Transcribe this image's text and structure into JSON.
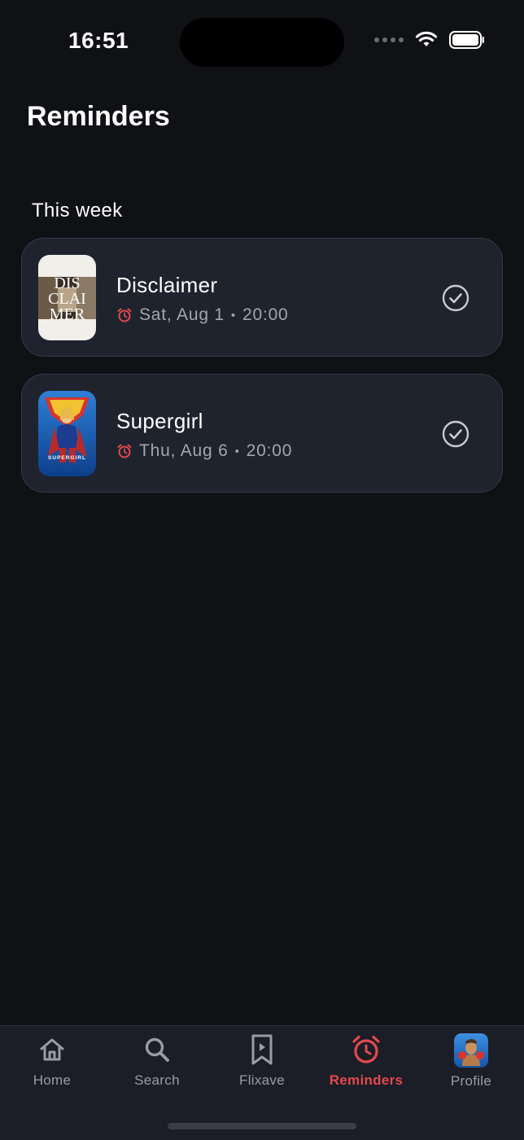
{
  "status": {
    "time": "16:51"
  },
  "header": {
    "title": "Reminders"
  },
  "section": {
    "title": "This week"
  },
  "reminders": [
    {
      "title": "Disclaimer",
      "day": "Sat, Aug 1",
      "time": "20:00",
      "poster_text": [
        "DIS",
        "CLAI",
        "MER"
      ]
    },
    {
      "title": "Supergirl",
      "day": "Thu, Aug 6",
      "time": "20:00",
      "poster_text": [
        "SUPERGIRL"
      ]
    }
  ],
  "separator": "•",
  "tabs": [
    {
      "label": "Home",
      "icon": "home-icon"
    },
    {
      "label": "Search",
      "icon": "search-icon"
    },
    {
      "label": "Flixave",
      "icon": "bookmark-icon"
    },
    {
      "label": "Reminders",
      "icon": "alarm-clock-icon",
      "active": true
    },
    {
      "label": "Profile",
      "icon": "avatar"
    }
  ],
  "colors": {
    "background": "#101115",
    "card": "#1f232e",
    "accent": "#e4494f",
    "muted": "#a3a6ae"
  }
}
